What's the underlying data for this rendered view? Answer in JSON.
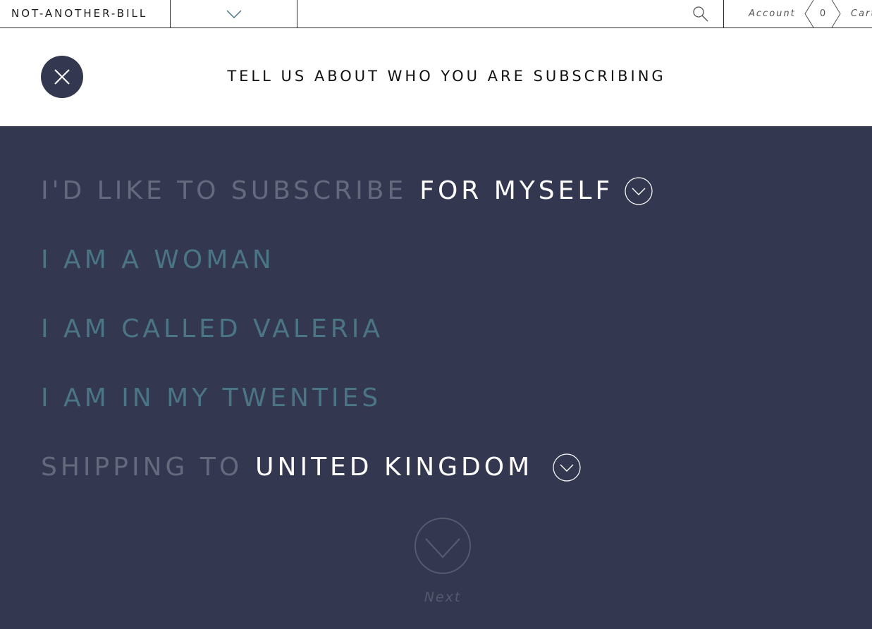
{
  "nav": {
    "brand": "NOT-ANOTHER-BILL",
    "account_label": "Account",
    "cart_count": "0",
    "cart_label": "Cart"
  },
  "panel": {
    "title": "TELL US ABOUT WHO YOU ARE SUBSCRIBING"
  },
  "form": {
    "subscribe_prefix": "I'D LIKE TO SUBSCRIBE",
    "subscribe_choice": "FOR MYSELF",
    "gender_line": "I AM A WOMAN",
    "name_line": "I AM CALLED VALERIA",
    "age_line": "I AM IN MY TWENTIES",
    "shipping_prefix": "SHIPPING TO",
    "shipping_choice": "UNITED KINGDOM",
    "next_label": "Next"
  },
  "colors": {
    "background": "#343750",
    "muted_text": "#646a7e",
    "teal_text": "#4a7585",
    "choice_text": "#ffffff"
  }
}
